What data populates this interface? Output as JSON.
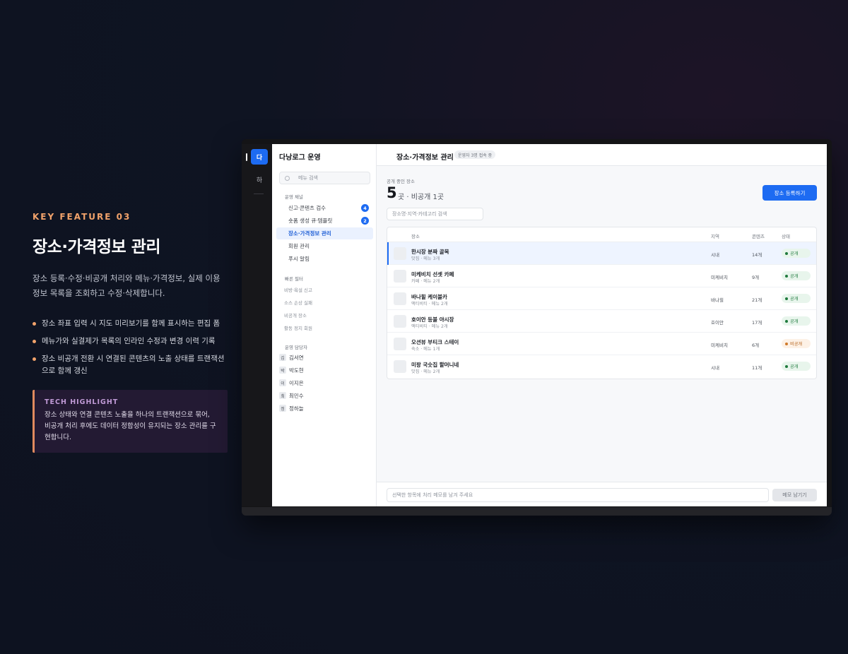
{
  "feature": {
    "kicker": "KEY FEATURE 03",
    "title": "장소·가격정보 관리",
    "description": "장소 등록·수정·비공개 처리와 메뉴·가격정보, 실제 이용정보 목록을 조회하고 수정·삭제합니다.",
    "bullets": [
      "장소 좌표 입력 시 지도 미리보기를 함께 표시하는 편집 폼",
      "메뉴가와 실결제가 목록의 인라인 수정과 변경 이력 기록",
      "장소 비공개 전환 시 연결된 콘텐츠의 노출 상태를 트랜잭션으로 함께 갱신"
    ],
    "tech_label": "TECH HIGHLIGHT",
    "tech_text": "장소 상태와 연결 콘텐츠 노출을 하나의 트랜잭션으로 묶어, 비공개 처리 후에도 데이터 정합성이 유지되는 장소 관리를 구현합니다."
  },
  "rail": {
    "active": "다",
    "second": "하"
  },
  "sidebar": {
    "title": "다낭로그 운영",
    "search_placeholder": "메뉴 검색",
    "group1": "운영 채널",
    "nav": [
      {
        "label": "신고·콘텐츠 검수",
        "badge": "4"
      },
      {
        "label": "숏폼 생성 큐·템플릿",
        "badge": "2"
      },
      {
        "label": "장소·가격정보 관리",
        "badge": ""
      },
      {
        "label": "회원 관리",
        "badge": ""
      },
      {
        "label": "푸시 알림",
        "badge": ""
      }
    ],
    "group2": "빠른 필터",
    "filters": [
      "비방·욕설 신고",
      "소스 손상 실패",
      "비공개 장소",
      "활동 정지 회원"
    ],
    "group3": "운영 담당자",
    "managers": [
      {
        "initial": "김",
        "name": "김서연"
      },
      {
        "initial": "박",
        "name": "박도현"
      },
      {
        "initial": "이",
        "name": "이지은"
      },
      {
        "initial": "최",
        "name": "최민수"
      },
      {
        "initial": "정",
        "name": "정하늘"
      }
    ]
  },
  "main": {
    "title": "장소·가격정보 관리",
    "online_badge": "운영자 3명 접속 중",
    "stat_label": "공개 중인 장소",
    "stat_count": "5",
    "stat_sub": "곳 · 비공개 1곳",
    "register_button": "장소 등록하기",
    "search_placeholder": "장소명·지역·카테고리 검색",
    "columns": {
      "place": "장소",
      "region": "지역",
      "content": "콘텐츠",
      "status": "상태"
    },
    "rows": [
      {
        "name": "한시장 분짜 골목",
        "meta": "맛집 · 메뉴 3개",
        "region": "시내",
        "count": "14개",
        "status": "공개"
      },
      {
        "name": "미케비치 선셋 카페",
        "meta": "카페 · 메뉴 2개",
        "region": "미케비치",
        "count": "9개",
        "status": "공개"
      },
      {
        "name": "바나힐 케이블카",
        "meta": "액티비티 · 메뉴 2개",
        "region": "바나힐",
        "count": "21개",
        "status": "공개"
      },
      {
        "name": "호이안 등불 야시장",
        "meta": "액티비티 · 메뉴 2개",
        "region": "호이안",
        "count": "17개",
        "status": "공개"
      },
      {
        "name": "오션뷰 부티크 스테이",
        "meta": "숙소 · 메뉴 1개",
        "region": "미케비치",
        "count": "6개",
        "status": "비공개"
      },
      {
        "name": "미팡 국숫집 할머니네",
        "meta": "맛집 · 메뉴 2개",
        "region": "시내",
        "count": "11개",
        "status": "공개"
      }
    ],
    "memo_placeholder": "선택한 항목에 처리 메모를 남겨 주세요",
    "memo_button": "메모 남기기"
  }
}
